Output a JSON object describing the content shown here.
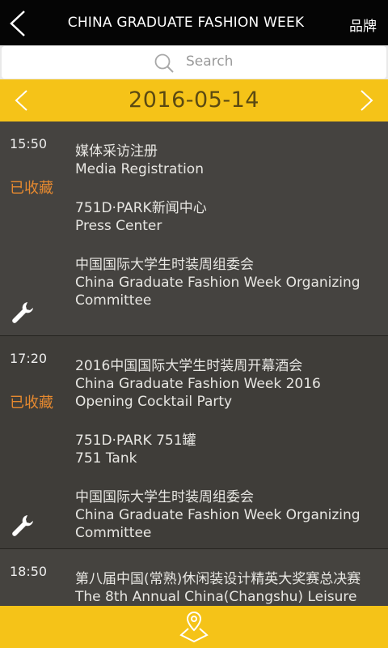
{
  "header": {
    "title": "CHINA GRADUATE FASHION WEEK",
    "right_label": "品牌",
    "back_icon": "chevron-left-icon"
  },
  "search": {
    "placeholder": "Search",
    "icon": "search-icon"
  },
  "date_nav": {
    "date": "2016-05-14",
    "prev_icon": "chevron-left-icon",
    "next_icon": "chevron-right-icon"
  },
  "events": [
    {
      "time": "15:50",
      "status": "已收藏",
      "title_zh": "媒体采访注册",
      "title_en": "Media Registration",
      "venue_zh": "751D·PARK新闻中心",
      "venue_en": "Press Center",
      "organizer_zh": "中国国际大学生时装周组委会",
      "organizer_en": "China Graduate Fashion Week Organizing Committee",
      "icon": "wrench-icon"
    },
    {
      "time": "17:20",
      "status": "已收藏",
      "title_zh": "2016中国国际大学生时装周开幕酒会",
      "title_en": "China Graduate Fashion Week 2016 Opening Cocktail Party",
      "venue_zh": "751D·PARK 751罐",
      "venue_en": "751 Tank",
      "organizer_zh": "中国国际大学生时装周组委会",
      "organizer_en": "China Graduate Fashion Week Organizing Committee",
      "icon": "wrench-icon"
    },
    {
      "time": "18:50",
      "title_zh": "第八届中国(常熟)休闲装设计精英大奖赛总决赛",
      "title_en": "The 8th Annual China(Changshu) Leisure"
    }
  ],
  "bottom_bar": {
    "icon": "map-pin-icon"
  },
  "colors": {
    "accent": "#f5c318",
    "favorite": "#e6892f",
    "list_bg": "#454340"
  }
}
